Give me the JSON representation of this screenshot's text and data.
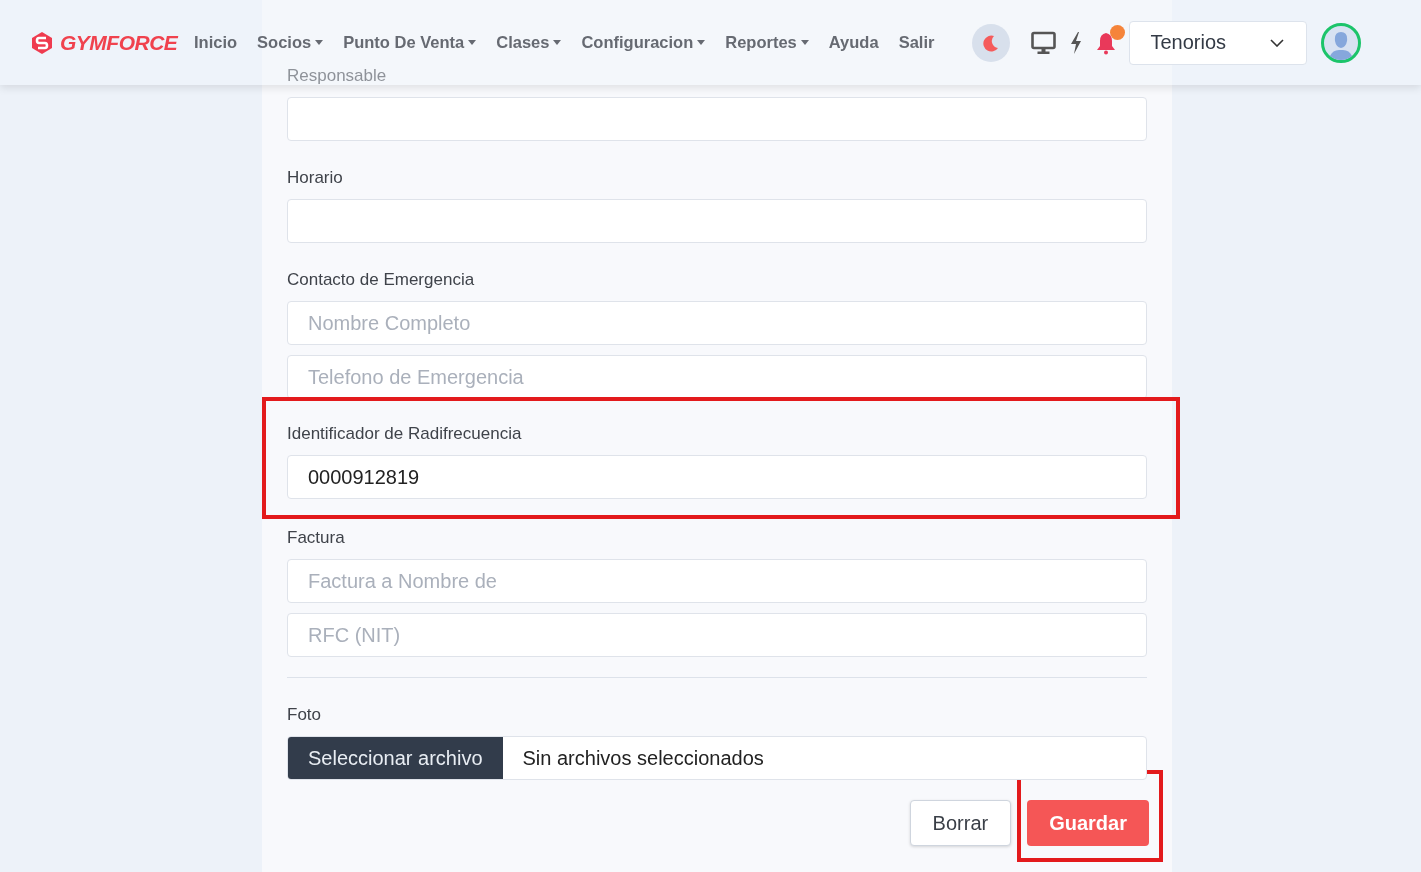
{
  "navbar": {
    "brand": "GYMFORCE",
    "menu": [
      {
        "label": "Inicio",
        "dropdown": false
      },
      {
        "label": "Socios",
        "dropdown": true
      },
      {
        "label": "Punto De Venta",
        "dropdown": true
      },
      {
        "label": "Clases",
        "dropdown": true
      },
      {
        "label": "Configuracion",
        "dropdown": true
      },
      {
        "label": "Reportes",
        "dropdown": true
      },
      {
        "label": "Ayuda",
        "dropdown": false
      },
      {
        "label": "Salir",
        "dropdown": false
      }
    ],
    "notification_dot": true,
    "branch_select": {
      "value": "Tenorios"
    }
  },
  "form": {
    "sections": [
      {
        "label": "Responsable",
        "highlighted": false
      },
      {
        "label": "Horario",
        "highlighted": false
      },
      {
        "label": "Contacto de Emergencia",
        "highlighted": false,
        "inputs": [
          {
            "placeholder": "Nombre Completo"
          },
          {
            "placeholder": "Telefono de Emergencia"
          }
        ]
      },
      {
        "label": "Identificador de Radifrecuencia",
        "highlighted": true,
        "inputs": [
          {
            "value": "0000912819"
          }
        ]
      },
      {
        "label": "Factura",
        "highlighted": false,
        "inputs": [
          {
            "placeholder": "Factura a Nombre de"
          },
          {
            "placeholder": "RFC (NIT)"
          }
        ]
      }
    ],
    "photo": {
      "label": "Foto",
      "button": "Seleccionar archivo",
      "status": "Sin archivos seleccionados"
    },
    "buttons": [
      {
        "label": "Borrar",
        "kind": "secondary",
        "highlighted": false
      },
      {
        "label": "Guardar",
        "kind": "primary",
        "highlighted": true
      }
    ]
  }
}
